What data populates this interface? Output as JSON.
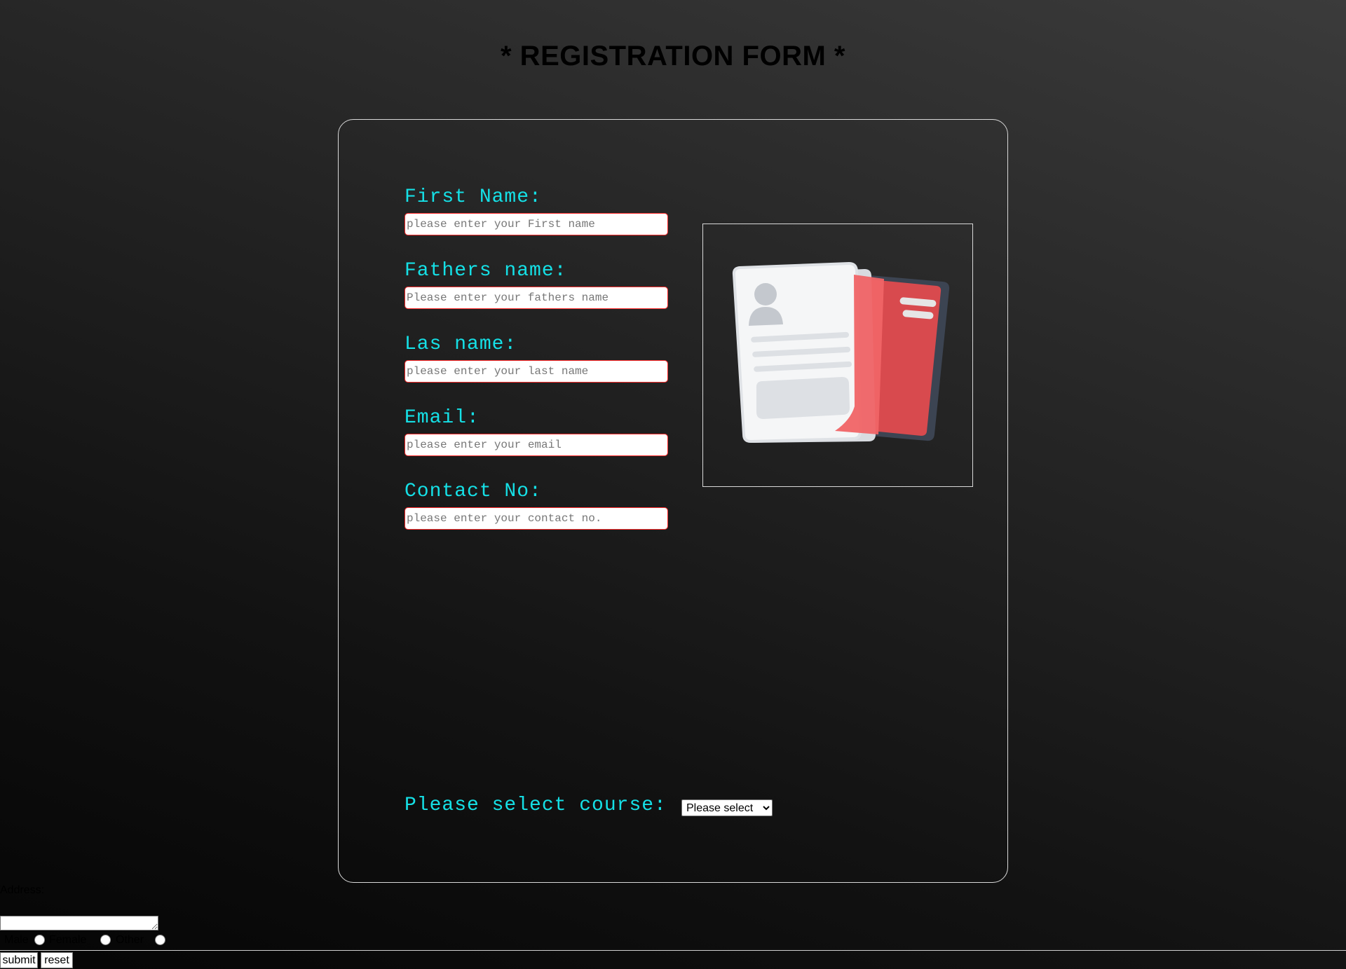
{
  "page": {
    "title": "* REGISTRATION FORM *"
  },
  "form": {
    "fields": [
      {
        "label": "First Name:",
        "placeholder": "please enter your First name",
        "value": ""
      },
      {
        "label": "Fathers name:",
        "placeholder": "Please enter your fathers name",
        "value": ""
      },
      {
        "label": "Las name:",
        "placeholder": "please enter your last name",
        "value": ""
      },
      {
        "label": "Email:",
        "placeholder": "please enter your email",
        "value": ""
      },
      {
        "label": "Contact No:",
        "placeholder": "please enter your contact no.",
        "value": ""
      }
    ],
    "course": {
      "label": "Please select course:",
      "selected": "Please select"
    },
    "image_icon": "registration-document-icon"
  },
  "outside": {
    "address_label": "Address:",
    "gender_options": [
      "Male",
      "Female",
      "Other"
    ],
    "submit_label": "submit",
    "reset_label": "reset"
  },
  "colors": {
    "label": "#15e0e6",
    "input_border": "#ff2a2a",
    "card_border": "#d9d9d9",
    "document_red": "#e84c4f"
  }
}
